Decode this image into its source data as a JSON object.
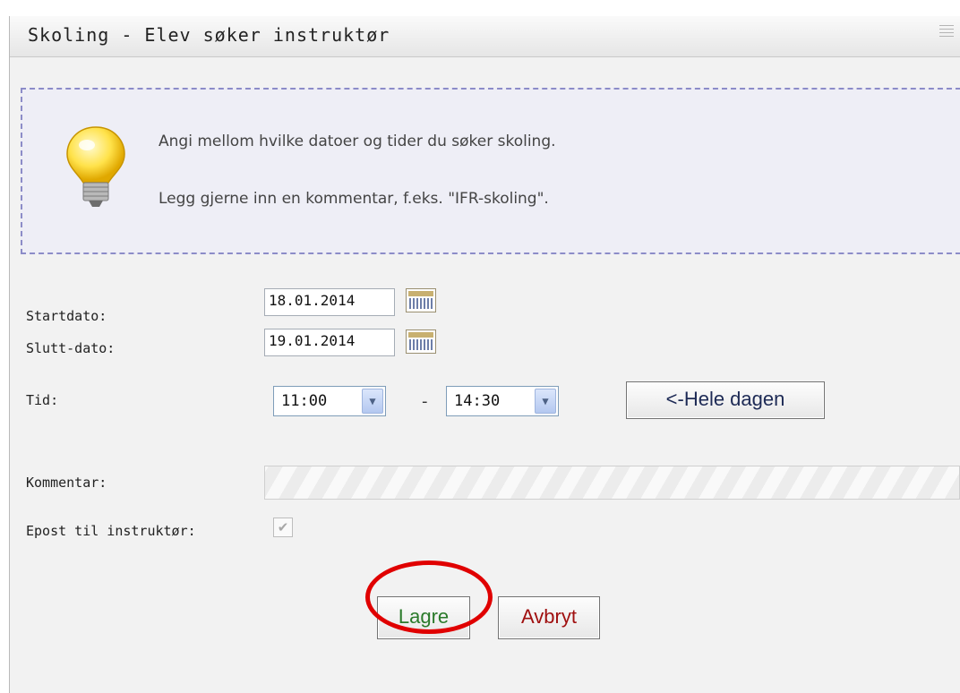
{
  "page": {
    "top_strip_text": "",
    "title": "Skoling - Elev søker instruktør"
  },
  "info": {
    "line1": "Angi mellom hvilke datoer og tider du søker skoling.",
    "line2": "Legg gjerne inn en kommentar, f.eks. \"IFR-skoling\".",
    "icon": "lightbulb-icon"
  },
  "form": {
    "start_label": "Startdato:",
    "start_value": "18.01.2014",
    "end_label": "Slutt-dato:",
    "end_value": "19.01.2014",
    "time_label": "Tid:",
    "time_from": "11:00",
    "time_separator": "-",
    "time_to": "14:30",
    "whole_day_label": "<-Hele dagen",
    "comment_label": "Kommentar:",
    "comment_value": "",
    "email_label": "Epost til instruktør:",
    "email_checked": true
  },
  "actions": {
    "save_label": "Lagre",
    "cancel_label": "Avbryt"
  },
  "colors": {
    "save_text": "#2a7a2a",
    "cancel_text": "#a01010",
    "highlight": "#e00000",
    "info_border": "#8c8cc8"
  }
}
